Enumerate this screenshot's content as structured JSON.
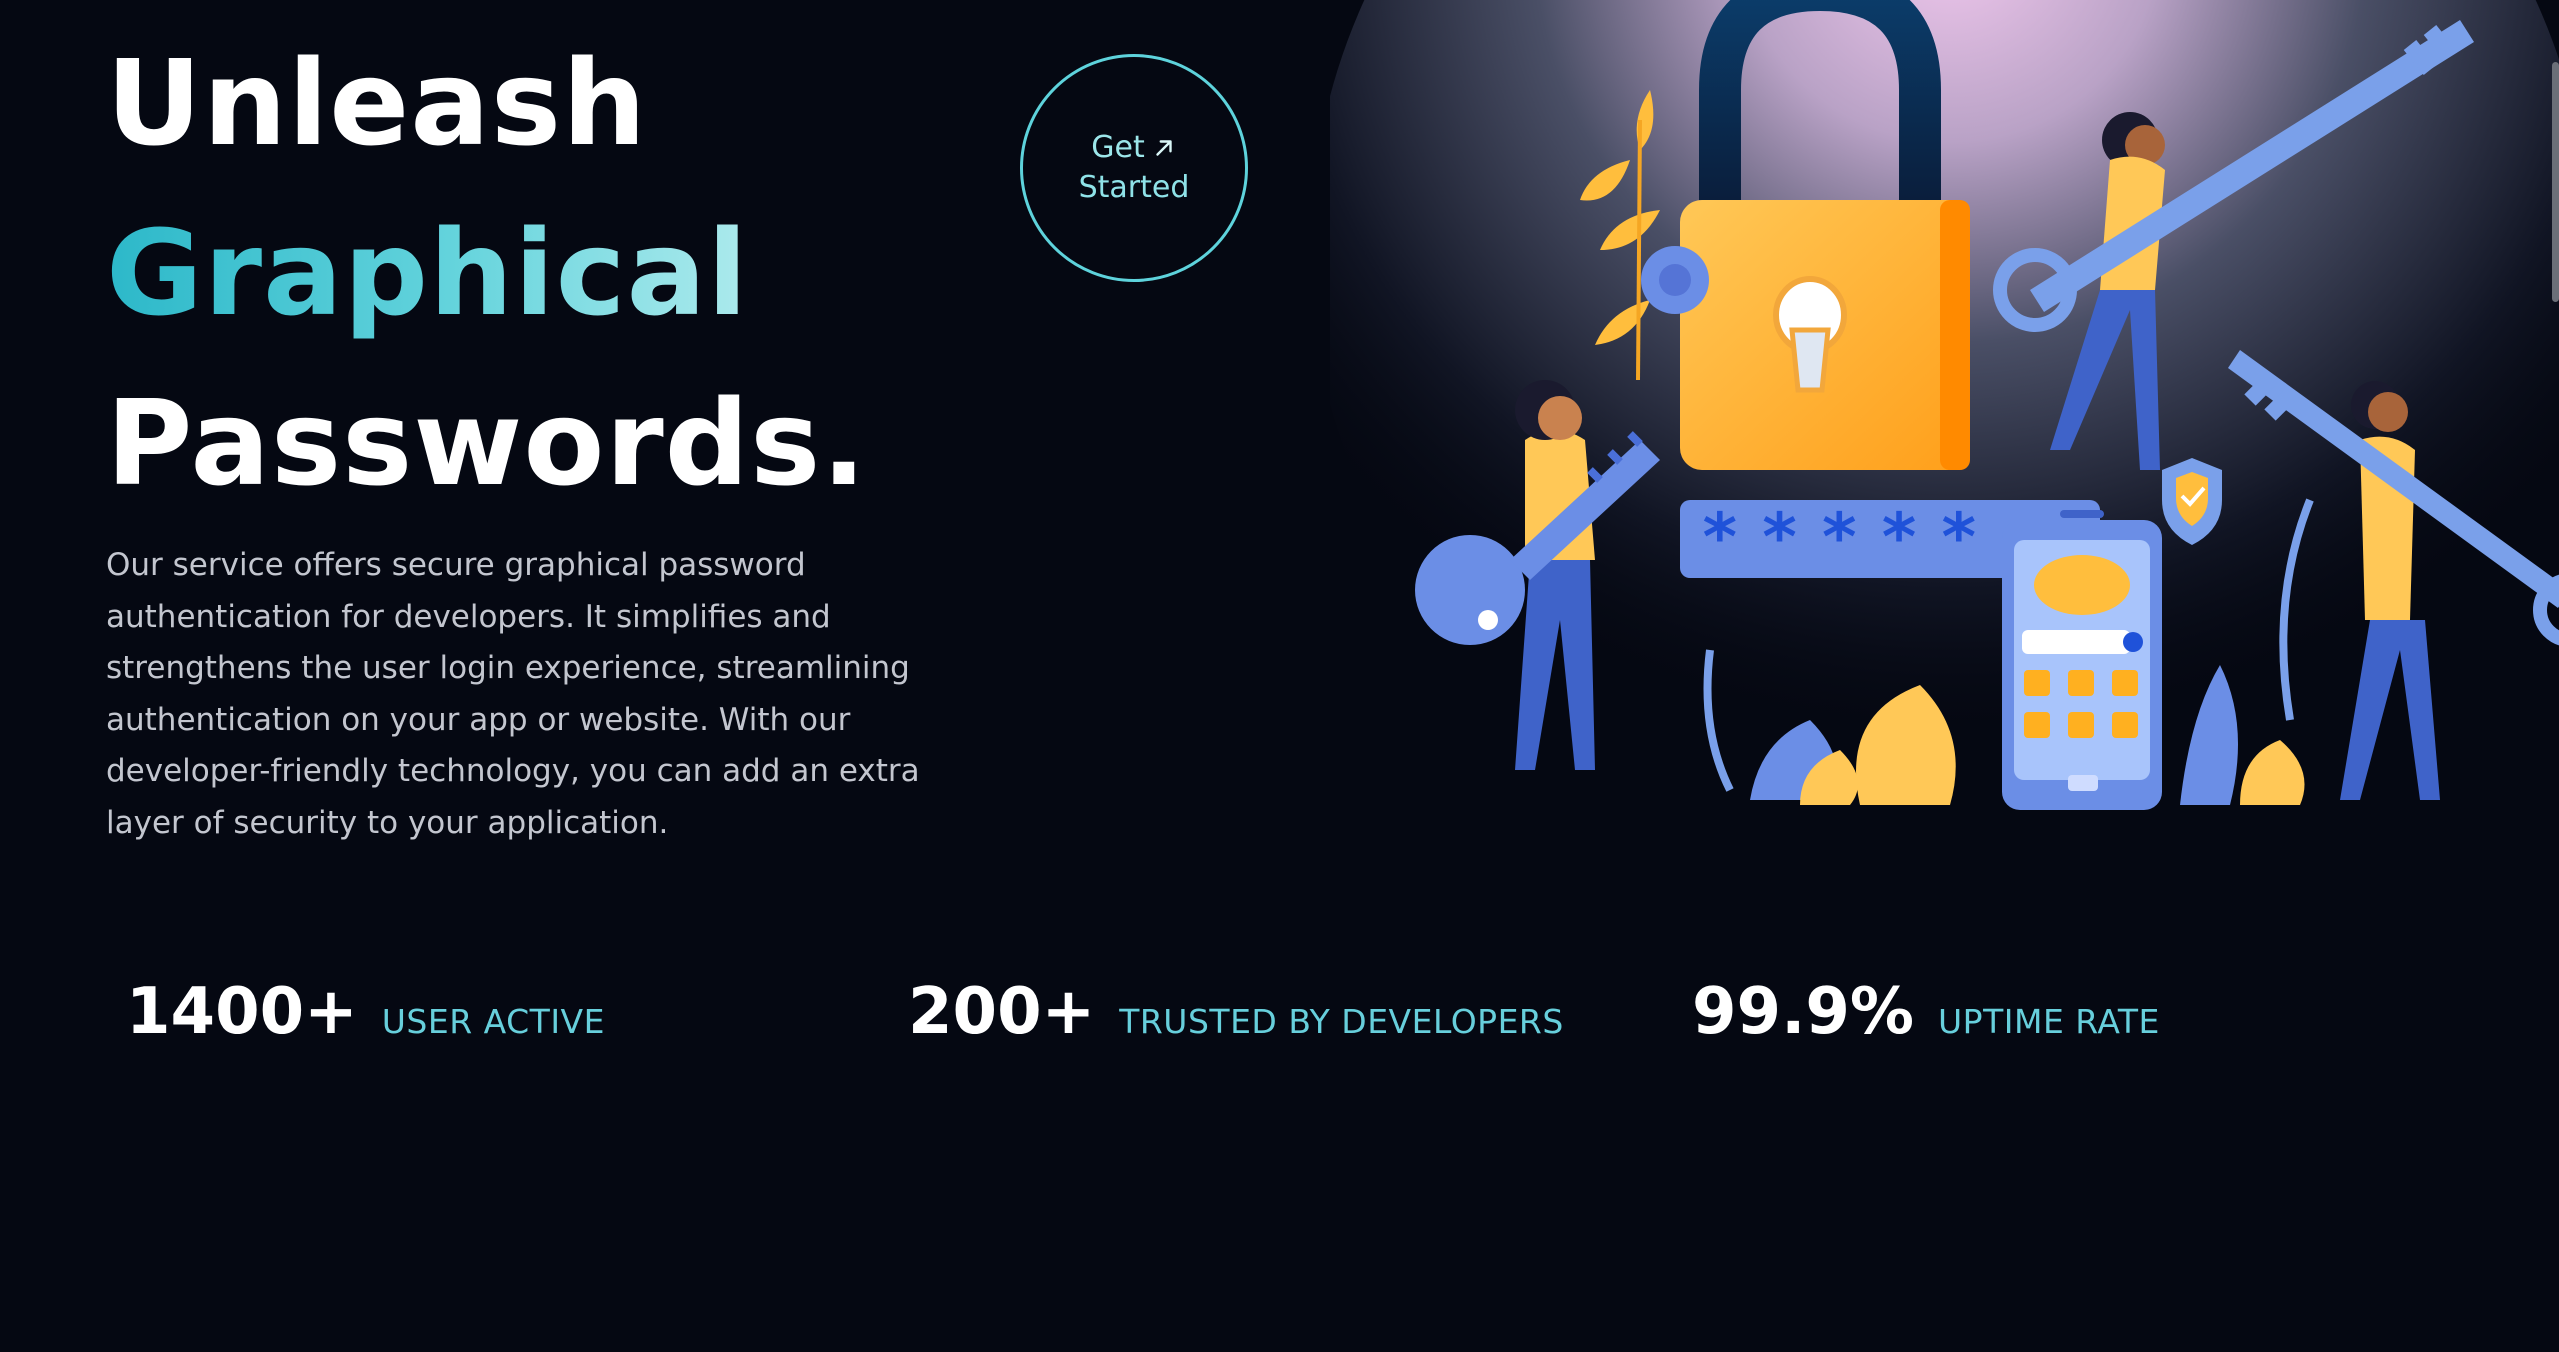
{
  "hero": {
    "title_line1": "Unleash",
    "title_line2": "Graphical",
    "title_line3": "Passwords.",
    "description": "Our service offers secure graphical password authentication for developers. It simplifies and strengthens the user login experience, streamlining authentication on your app or website. With our developer-friendly technology, you can add an extra layer of security to your application."
  },
  "cta": {
    "line1": "Get",
    "line2": "Started",
    "icon": "arrow-up-right-icon"
  },
  "stats": [
    {
      "value": "1400+",
      "label": "USER ACTIVE"
    },
    {
      "value": "200+",
      "label": "TRUSTED BY DEVELOPERS"
    },
    {
      "value": "99.9%",
      "label": "UPTIME RATE"
    }
  ],
  "illustration": {
    "password_mask": "*****"
  },
  "colors": {
    "background": "#050812",
    "accent": "#5ed3dc",
    "text": "#ffffff",
    "muted_text": "#c3c6cf",
    "lock_body": "#ffb733",
    "key_blue": "#6b8ee6"
  }
}
